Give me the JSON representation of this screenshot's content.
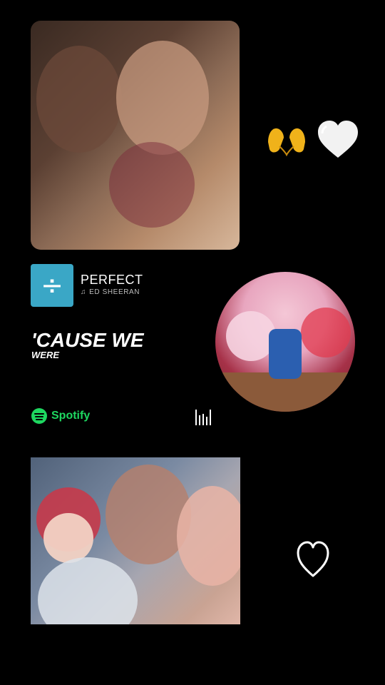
{
  "emojis": {
    "left": "hand-heart-emoji",
    "right": "white-heart-emoji"
  },
  "music": {
    "album_symbol": "÷",
    "title": "PERFECT",
    "artist": "ED SHEERAN",
    "lyric_main": "'CAUSE WE",
    "lyric_sub": "WERE",
    "provider": "Spotify"
  },
  "colors": {
    "spotify_green": "#1ed760",
    "album_blue": "#3aa7c6",
    "background": "#000000"
  }
}
